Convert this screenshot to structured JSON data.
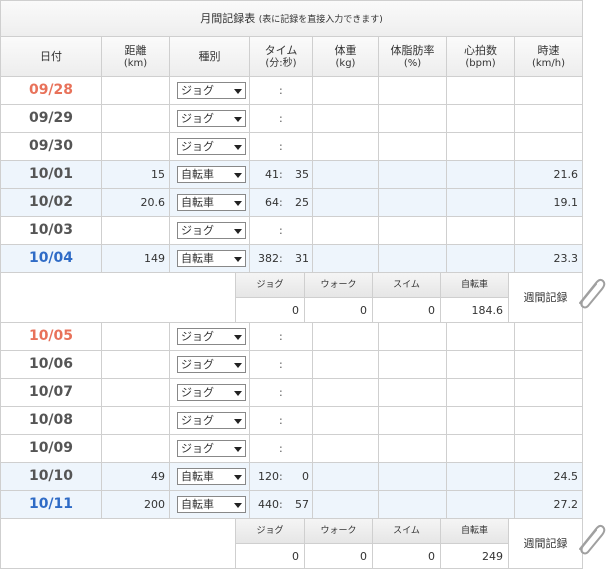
{
  "title": {
    "main": "月間記録表",
    "sub": "(表に記録を直接入力できます)"
  },
  "headers": [
    {
      "label": "日付",
      "unit": ""
    },
    {
      "label": "距離",
      "unit": "(km)"
    },
    {
      "label": "種別",
      "unit": ""
    },
    {
      "label": "タイム",
      "unit": "(分:秒)"
    },
    {
      "label": "体重",
      "unit": "(kg)"
    },
    {
      "label": "体脂肪率",
      "unit": "(%)"
    },
    {
      "label": "心拍数",
      "unit": "(bpm)"
    },
    {
      "label": "時速",
      "unit": "(km/h)"
    }
  ],
  "time_separator": ":",
  "colors": {
    "sunday": "#e8725a",
    "saturday": "#2f6bc6",
    "weekday": "#555555",
    "row_alt": "#eef5fc",
    "border": "#cfcfcf"
  },
  "weeks": [
    {
      "days": [
        {
          "date": "09/28",
          "day_type": "sunday",
          "distance": "",
          "type": "ジョグ",
          "min": "",
          "sec": "",
          "speed": "",
          "highlight": false
        },
        {
          "date": "09/29",
          "day_type": "weekday",
          "distance": "",
          "type": "ジョグ",
          "min": "",
          "sec": "",
          "speed": "",
          "highlight": false
        },
        {
          "date": "09/30",
          "day_type": "weekday",
          "distance": "",
          "type": "ジョグ",
          "min": "",
          "sec": "",
          "speed": "",
          "highlight": false
        },
        {
          "date": "10/01",
          "day_type": "weekday",
          "distance": "15",
          "type": "自転車",
          "min": "41",
          "sec": "35",
          "speed": "21.6",
          "highlight": true
        },
        {
          "date": "10/02",
          "day_type": "weekday",
          "distance": "20.6",
          "type": "自転車",
          "min": "64",
          "sec": "25",
          "speed": "19.1",
          "highlight": true
        },
        {
          "date": "10/03",
          "day_type": "weekday",
          "distance": "",
          "type": "ジョグ",
          "min": "",
          "sec": "",
          "speed": "",
          "highlight": false
        },
        {
          "date": "10/04",
          "day_type": "saturday",
          "distance": "149",
          "type": "自転車",
          "min": "382",
          "sec": "31",
          "speed": "23.3",
          "highlight": true
        }
      ],
      "summary": {
        "labels": [
          "ジョグ",
          "ウォーク",
          "スイム",
          "自転車"
        ],
        "values": [
          "0",
          "0",
          "0",
          "184.6"
        ],
        "button": "週間記録"
      }
    },
    {
      "days": [
        {
          "date": "10/05",
          "day_type": "sunday",
          "distance": "",
          "type": "ジョグ",
          "min": "",
          "sec": "",
          "speed": "",
          "highlight": false
        },
        {
          "date": "10/06",
          "day_type": "weekday",
          "distance": "",
          "type": "ジョグ",
          "min": "",
          "sec": "",
          "speed": "",
          "highlight": false
        },
        {
          "date": "10/07",
          "day_type": "weekday",
          "distance": "",
          "type": "ジョグ",
          "min": "",
          "sec": "",
          "speed": "",
          "highlight": false
        },
        {
          "date": "10/08",
          "day_type": "weekday",
          "distance": "",
          "type": "ジョグ",
          "min": "",
          "sec": "",
          "speed": "",
          "highlight": false
        },
        {
          "date": "10/09",
          "day_type": "weekday",
          "distance": "",
          "type": "ジョグ",
          "min": "",
          "sec": "",
          "speed": "",
          "highlight": false
        },
        {
          "date": "10/10",
          "day_type": "weekday",
          "distance": "49",
          "type": "自転車",
          "min": "120",
          "sec": "0",
          "speed": "24.5",
          "highlight": true
        },
        {
          "date": "10/11",
          "day_type": "saturday",
          "distance": "200",
          "type": "自転車",
          "min": "440",
          "sec": "57",
          "speed": "27.2",
          "highlight": true
        }
      ],
      "summary": {
        "labels": [
          "ジョグ",
          "ウォーク",
          "スイム",
          "自転車"
        ],
        "values": [
          "0",
          "0",
          "0",
          "249"
        ],
        "button": "週間記録"
      }
    }
  ]
}
